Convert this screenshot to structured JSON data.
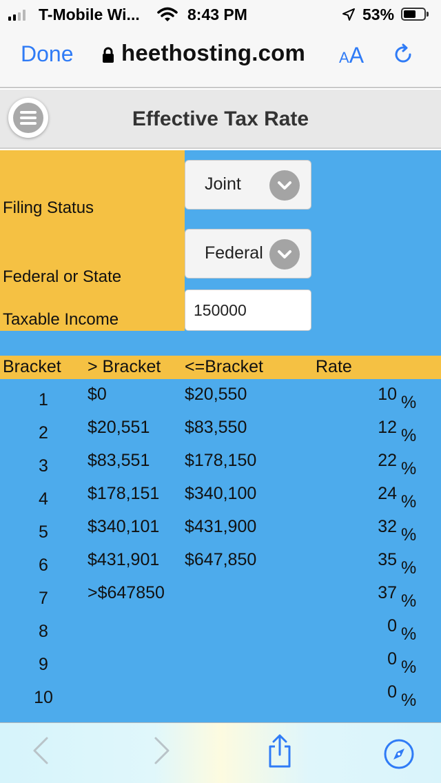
{
  "status_bar": {
    "carrier": "T-Mobile Wi...",
    "time": "8:43 PM",
    "battery": "53%",
    "icons": [
      "signal-icon",
      "wifi-icon",
      "location-icon",
      "battery-icon"
    ]
  },
  "browser": {
    "done_label": "Done",
    "domain": "heethosting.com",
    "reader_small": "A",
    "reader_big": "A",
    "icons": [
      "lock-icon",
      "reload-icon"
    ]
  },
  "app": {
    "title": "Effective Tax Rate",
    "menu_icon": "hamburger-menu-icon"
  },
  "form": {
    "filing_status_label": "Filing Status",
    "filing_status_value": "Joint",
    "jurisdiction_label": "Federal or State",
    "jurisdiction_value": "Federal",
    "income_label": "Taxable Income",
    "income_value": "150000"
  },
  "table": {
    "headers": {
      "bracket": "Bracket",
      "lower": "> Bracket",
      "upper": "<=Bracket",
      "rate": "Rate"
    },
    "percent_sign": "%",
    "rows": [
      {
        "num": "1",
        "low": "$0",
        "high": "$20,550",
        "rate": "10"
      },
      {
        "num": "2",
        "low": "$20,551",
        "high": "$83,550",
        "rate": "12"
      },
      {
        "num": "3",
        "low": "$83,551",
        "high": "$178,150",
        "rate": "22"
      },
      {
        "num": "4",
        "low": "$178,151",
        "high": "$340,100",
        "rate": "24"
      },
      {
        "num": "5",
        "low": "$340,101",
        "high": "$431,900",
        "rate": "32"
      },
      {
        "num": "6",
        "low": "$431,901",
        "high": "$647,850",
        "rate": "35"
      },
      {
        "num": "7",
        "low": ">$647850",
        "high": "",
        "rate": "37"
      },
      {
        "num": "8",
        "low": "",
        "high": "",
        "rate": "0"
      },
      {
        "num": "9",
        "low": "",
        "high": "",
        "rate": "0"
      },
      {
        "num": "10",
        "low": "",
        "high": "",
        "rate": "0"
      }
    ]
  },
  "toolbar": {
    "icons": [
      "back-icon",
      "forward-icon",
      "share-icon",
      "safari-compass-icon"
    ]
  },
  "colors": {
    "accent_blue": "#2f7bf6",
    "panel_yellow": "#f5c143",
    "panel_blue": "#4dabec"
  }
}
